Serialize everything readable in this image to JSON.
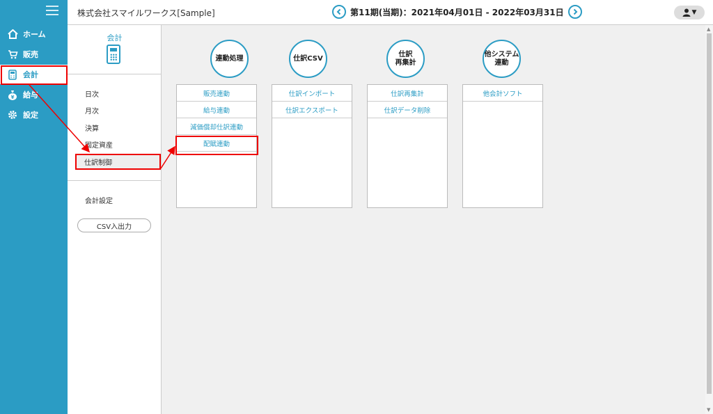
{
  "nav": {
    "items": [
      {
        "label": "ホーム",
        "icon": "home-icon"
      },
      {
        "label": "販売",
        "icon": "cart-icon"
      },
      {
        "label": "会計",
        "icon": "calculator-icon",
        "active": true
      },
      {
        "label": "給与",
        "icon": "money-bag-icon"
      },
      {
        "label": "設定",
        "icon": "gear-icon"
      }
    ]
  },
  "header": {
    "company": "株式会社スマイルワークス[Sample]",
    "period": "第11期(当期)：2021年04月01日 - 2022年03月31日",
    "prev": "<",
    "next": ">",
    "user_icon": "▼"
  },
  "submenu": {
    "title": "会計",
    "items": [
      "日次",
      "月次",
      "決算",
      "固定資産",
      "仕訳制御"
    ],
    "settings": "会計設定",
    "csv_button": "CSV入出力"
  },
  "groups": [
    {
      "title": "連動処理",
      "items": [
        "販売連動",
        "給与連動",
        "減価償却仕訳連動",
        "配賦連動"
      ]
    },
    {
      "title": "仕訳CSV",
      "items": [
        "仕訳インポート",
        "仕訳エクスポート"
      ]
    },
    {
      "title": "仕訳\n再集計",
      "items": [
        "仕訳再集計",
        "仕訳データ削除"
      ]
    },
    {
      "title": "他システム\n連動",
      "items": [
        "他会計ソフト"
      ]
    }
  ],
  "colors": {
    "accent": "#2b9cc4",
    "highlight": "#ee0000"
  }
}
